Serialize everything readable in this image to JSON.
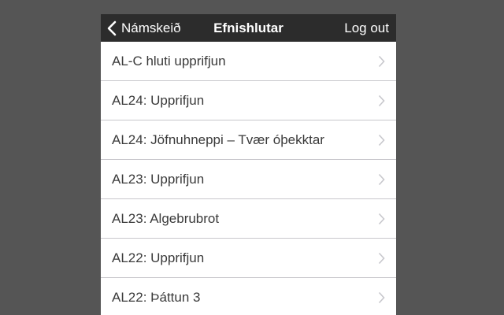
{
  "navbar": {
    "back_label": "Námskeið",
    "title": "Efnishlutar",
    "logout_label": "Log out",
    "back_icon": "chevron-left-icon"
  },
  "list": {
    "items": [
      {
        "label": "AL-C hluti upprifjun"
      },
      {
        "label": "AL24: Upprifjun"
      },
      {
        "label": "AL24: Jöfnuhneppi – Tvær óþekktar"
      },
      {
        "label": "AL23: Upprifjun"
      },
      {
        "label": "AL23: Algebrubrot"
      },
      {
        "label": "AL22: Upprifjun"
      },
      {
        "label": "AL22: Þáttun 3"
      }
    ],
    "row_icon": "chevron-right-icon"
  },
  "colors": {
    "navbar_bg": "#2c2c2c",
    "page_bg": "#555555",
    "list_bg": "#ffffff",
    "separator": "#c8c7cc",
    "chevron": "#c7c7cc"
  }
}
